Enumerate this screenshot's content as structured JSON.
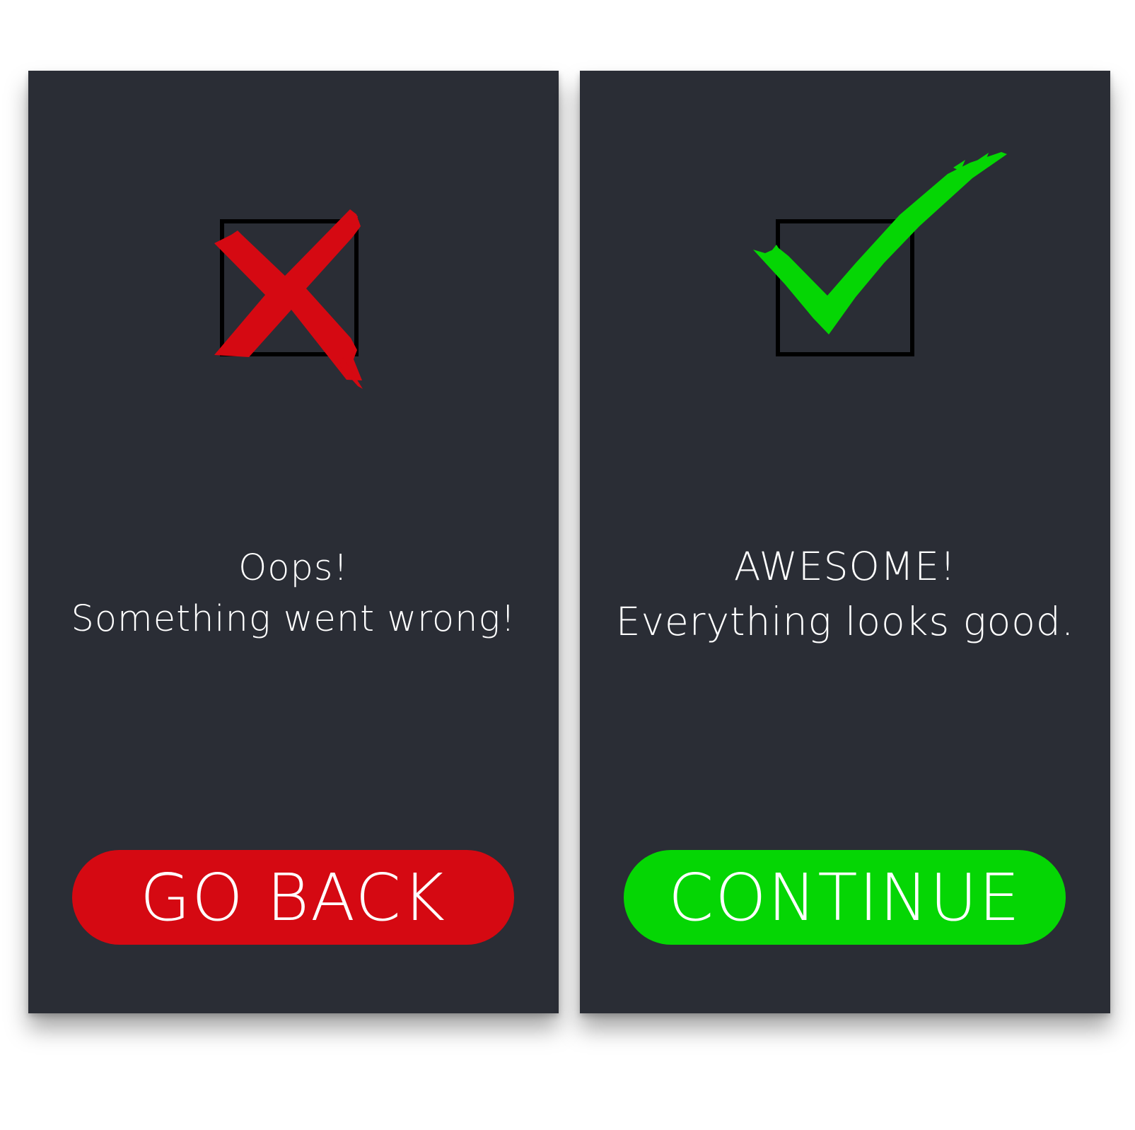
{
  "colors": {
    "panel_background": "#2a2d35",
    "error_accent": "#d50912",
    "success_accent": "#05d604",
    "text": "#ffffff",
    "checkbox_outline": "#000000"
  },
  "error_panel": {
    "icon": "red-x-mark-icon",
    "heading": "Oops!",
    "message": "Something went wrong!",
    "button_label": "GO BACK"
  },
  "success_panel": {
    "icon": "green-check-mark-icon",
    "heading": "AWESOME!",
    "message": "Everything looks good.",
    "button_label": "CONTINUE"
  }
}
